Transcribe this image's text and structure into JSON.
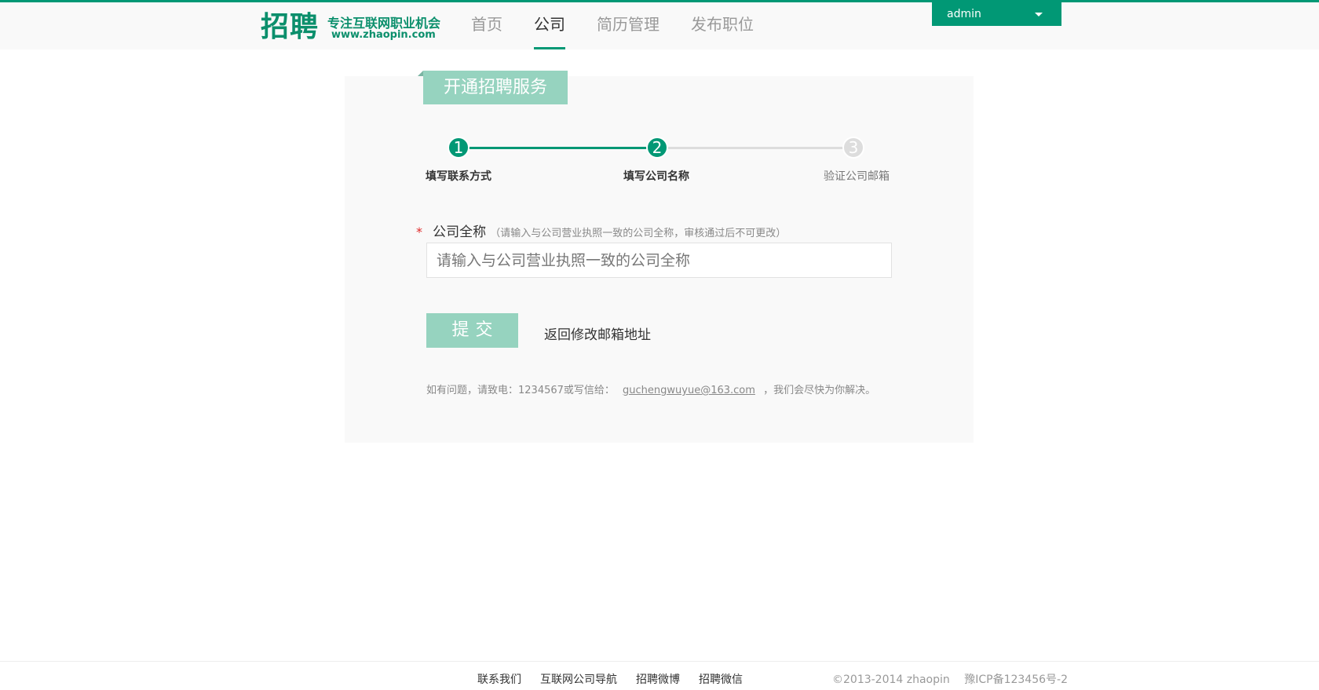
{
  "header": {
    "logo": {
      "big": "招聘",
      "slogan": "专注互联网职业机会",
      "url": "www.zhaopin.com"
    },
    "nav": [
      {
        "label": "首页",
        "active": false
      },
      {
        "label": "公司",
        "active": true
      },
      {
        "label": "简历管理",
        "active": false
      },
      {
        "label": "发布职位",
        "active": false
      }
    ],
    "user": {
      "name": "admin",
      "icon": "caret-down-icon"
    }
  },
  "panel": {
    "title": "开通招聘服务",
    "steps": [
      {
        "number": "1",
        "label": "填写联系方式",
        "status": "done"
      },
      {
        "number": "2",
        "label": "填写公司名称",
        "status": "done"
      },
      {
        "number": "3",
        "label": "验证公司邮箱",
        "status": "todo"
      }
    ],
    "field": {
      "required_mark": "*",
      "label": "公司全称",
      "hint": "（请输入与公司营业执照一致的公司全称，审核通过后不可更改）",
      "value": "",
      "placeholder": "请输入与公司营业执照一致的公司全称"
    },
    "submit_label": "提交",
    "back_link": "返回修改邮箱地址",
    "help": {
      "before": "如有问题，请致电：1234567或写信给：",
      "email": "guchengwuyue@163.com",
      "after": "，我们会尽快为你解决。"
    }
  },
  "footer": {
    "links": [
      "联系我们",
      "互联网公司导航",
      "招聘微博",
      "招聘微信"
    ],
    "copyright": "©2013-2014 zhaopin",
    "icp": "豫ICP备123456号-2"
  },
  "colors": {
    "accent": "#019875",
    "accent_light": "#96d3bf",
    "required": "#e02a2a",
    "inactive_step": "#dddddd"
  }
}
